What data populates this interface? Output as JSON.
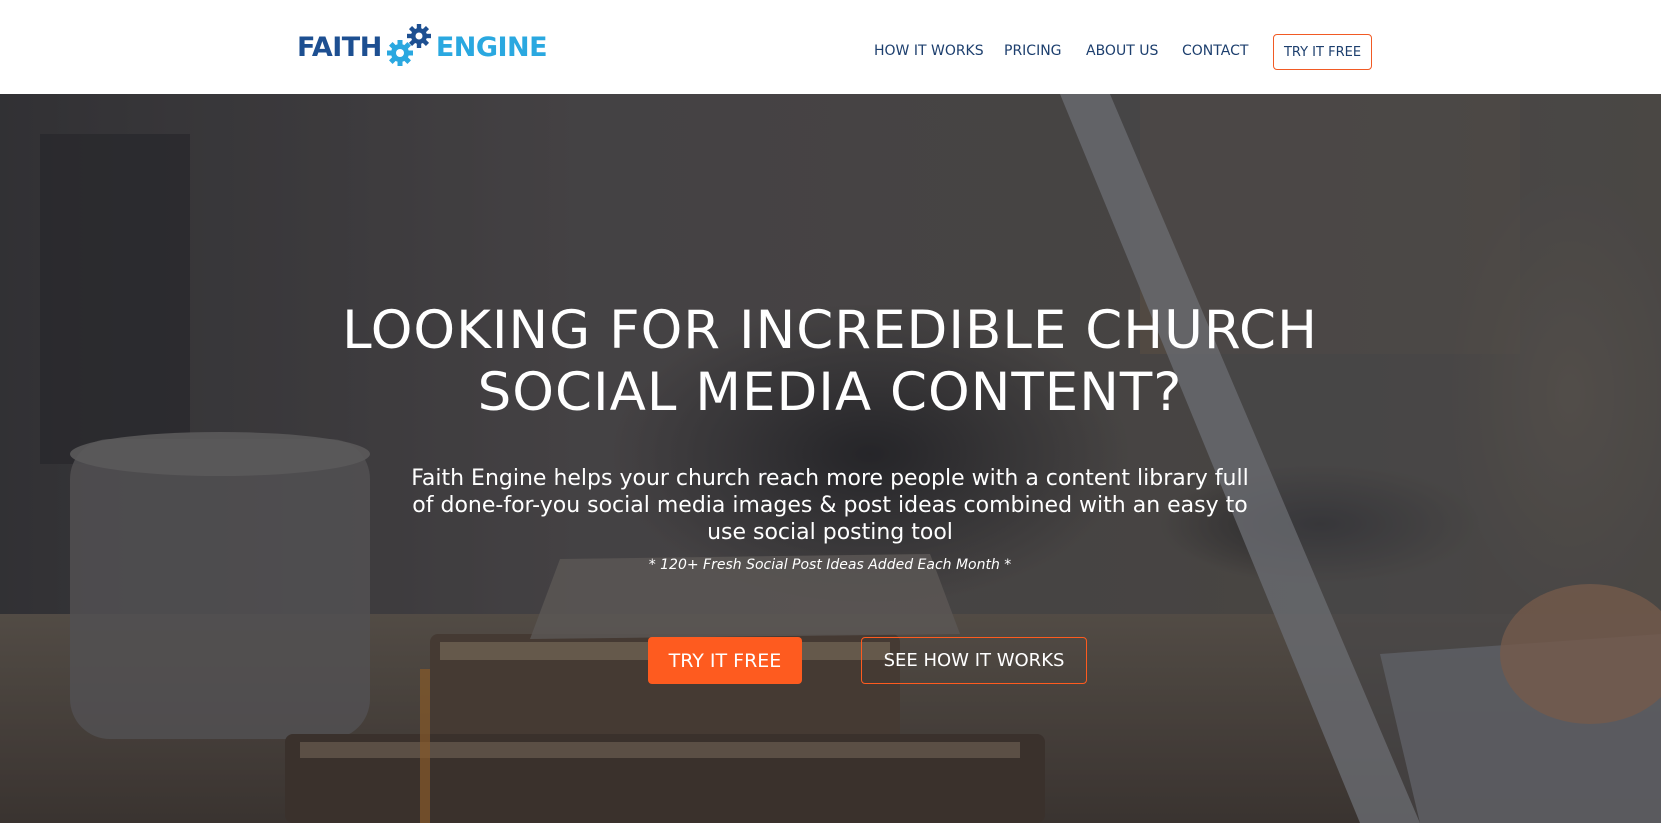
{
  "brand": {
    "word_left": "FAITH",
    "word_right": "ENGINE",
    "color_primary": "#1d4f91",
    "color_secondary": "#2aa8e0",
    "icon": "gear-icon"
  },
  "nav": {
    "items": [
      {
        "label": "HOW IT WORKS"
      },
      {
        "label": "PRICING"
      },
      {
        "label": "ABOUT US"
      },
      {
        "label": "CONTACT"
      }
    ],
    "cta_label": "TRY IT FREE"
  },
  "hero": {
    "title_line1": "LOOKING FOR INCREDIBLE CHURCH",
    "title_line2": "SOCIAL MEDIA CONTENT?",
    "subtitle_line1": "Faith Engine helps your church reach more people with a content library full",
    "subtitle_line2": "of done-for-you social media images & post ideas combined with an easy to",
    "subtitle_line3": "use social posting tool",
    "note": "* 120+ Fresh Social Post Ideas Added Each Month *",
    "primary_button": "TRY IT FREE",
    "secondary_button": "SEE HOW IT WORKS",
    "accent_color": "#fe5b1f"
  }
}
